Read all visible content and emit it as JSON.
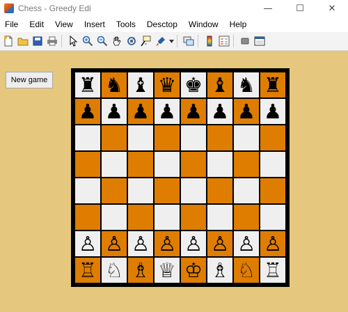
{
  "window": {
    "title": "Chess - Greedy Edi",
    "controls": {
      "minimize": "—",
      "maximize": "☐",
      "close": "✕"
    }
  },
  "menu": [
    "File",
    "Edit",
    "View",
    "Insert",
    "Tools",
    "Desctop",
    "Window",
    "Help"
  ],
  "toolbar": {
    "buttons": [
      "new-file-icon",
      "open-folder-icon",
      "save-icon",
      "print-icon",
      "separator",
      "pointer-icon",
      "zoom-in-icon",
      "zoom-out-icon",
      "pan-hand-icon",
      "rotate-3d-icon",
      "data-cursor-icon",
      "brush-icon",
      "dropdown-arrow-icon",
      "separator",
      "link-plot-icon",
      "separator",
      "colorbar-icon",
      "legend-icon",
      "separator",
      "hide-plot-tools-icon",
      "show-plot-tools-icon"
    ]
  },
  "new_game_label": "New game",
  "colors": {
    "light_square": "#efefef",
    "dark_square": "#de7d00",
    "background": "#e6c77e"
  },
  "board": [
    [
      "♜",
      "♞",
      "♝",
      "♛",
      "♚",
      "♝",
      "♞",
      "♜"
    ],
    [
      "♟",
      "♟",
      "♟",
      "♟",
      "♟",
      "♟",
      "♟",
      "♟"
    ],
    [
      "",
      "",
      "",
      "",
      "",
      "",
      "",
      ""
    ],
    [
      "",
      "",
      "",
      "",
      "",
      "",
      "",
      ""
    ],
    [
      "",
      "",
      "",
      "",
      "",
      "",
      "",
      ""
    ],
    [
      "",
      "",
      "",
      "",
      "",
      "",
      "",
      ""
    ],
    [
      "♙",
      "♙",
      "♙",
      "♙",
      "♙",
      "♙",
      "♙",
      "♙"
    ],
    [
      "♖",
      "♘",
      "♗",
      "♕",
      "♔",
      "♗",
      "♘",
      "♖"
    ]
  ]
}
